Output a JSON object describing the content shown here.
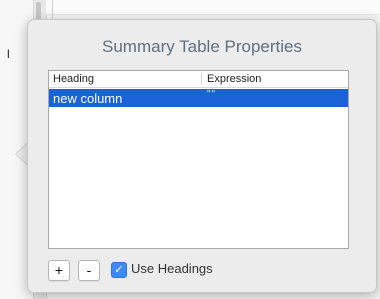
{
  "background": {
    "text_fragment": "l"
  },
  "popover": {
    "title": "Summary Table Properties",
    "table": {
      "columns": [
        "Heading",
        "Expression"
      ],
      "rows": [
        {
          "heading": "new column",
          "expression": "\"\"",
          "selected": true
        }
      ]
    },
    "buttons": {
      "add_label": "+",
      "remove_label": "-"
    },
    "use_headings": {
      "label": "Use Headings",
      "checked": true,
      "check_glyph": "✓"
    }
  },
  "colors": {
    "selection": "#1a62d6",
    "title": "#5f6f80",
    "checkbox": "#3c89f7"
  }
}
